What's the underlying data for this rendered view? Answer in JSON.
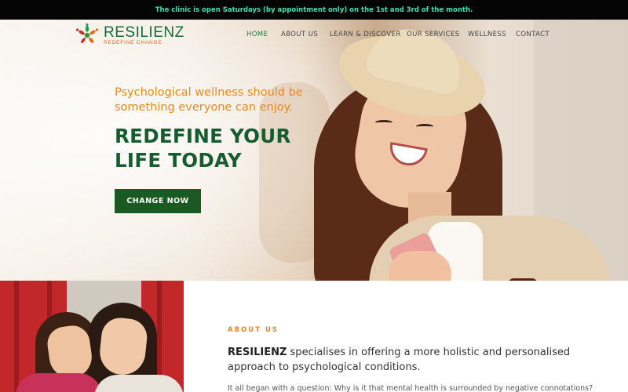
{
  "announcement": "The clinic is open Saturdays (by appointment only) on the 1st and 3rd of the month.",
  "brand": {
    "name": "RESILIENZ",
    "tagline": "REDEFINE CHANGE",
    "colors": {
      "green": "#176a33",
      "orange": "#e66a12",
      "red": "#d12b2b"
    }
  },
  "nav": {
    "items": [
      {
        "label": "HOME",
        "active": true
      },
      {
        "label": "ABOUT US",
        "active": false
      },
      {
        "label": "LEARN & DISCOVER",
        "active": false
      },
      {
        "label": "OUR SERVICES",
        "active": false
      },
      {
        "label": "WELLNESS",
        "active": false
      },
      {
        "label": "CONTACT",
        "active": false
      }
    ]
  },
  "hero": {
    "tagline": "Psychological wellness should be something everyone can enjoy.",
    "headline_line1": "REDEFINE YOUR",
    "headline_line2": "LIFE TODAY",
    "cta_label": "CHANGE NOW",
    "cta_color": "#1a5a22"
  },
  "about": {
    "label": "ABOUT US",
    "brand_word": "RESILIENZ",
    "intro": " specialises in offering a more holistic and personalised approach to psychological conditions.",
    "more": "It all began with a question: Why is it that mental health is surrounded by negative connotations?"
  }
}
